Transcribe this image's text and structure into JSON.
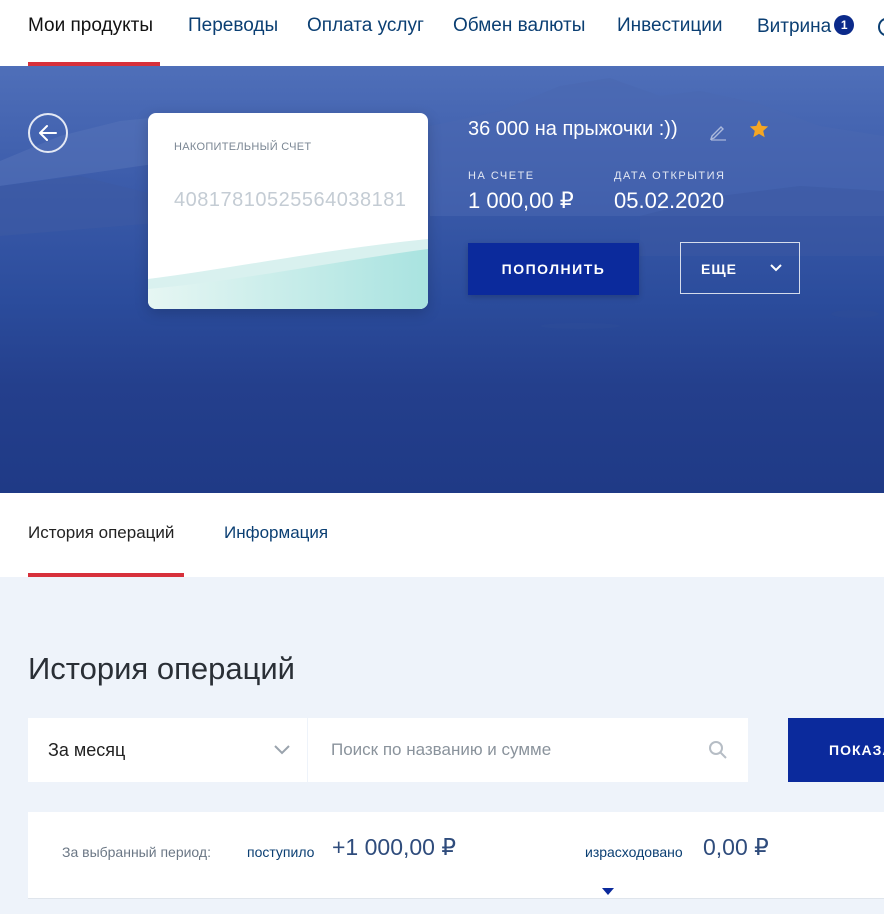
{
  "nav": {
    "items": [
      {
        "label": "Мои продукты",
        "active": true
      },
      {
        "label": "Переводы"
      },
      {
        "label": "Оплата услуг"
      },
      {
        "label": "Обмен валюты"
      },
      {
        "label": "Инвестиции"
      },
      {
        "label": "Витрина",
        "badge": "1"
      }
    ]
  },
  "account": {
    "card_label": "НАКОПИТЕЛЬНЫЙ СЧЕТ",
    "card_number": "40817810525564038181",
    "title": "36 000 на прыжочки :))",
    "balance_label": "НА СЧЕТЕ",
    "balance": "1 000,00 ₽",
    "open_date_label": "ДАТА ОТКРЫТИЯ",
    "open_date": "05.02.2020",
    "topup_button": "ПОПОЛНИТЬ",
    "more_button": "ЕЩЕ",
    "favorite": true
  },
  "tabs": [
    {
      "label": "История операций",
      "active": true
    },
    {
      "label": "Информация"
    }
  ],
  "history": {
    "title": "История операций",
    "period": "За месяц",
    "search_placeholder": "Поиск по названию и сумме",
    "show_button": "ПОКАЗАТЬ",
    "summary": {
      "period_label": "За выбранный период:",
      "income_label": "поступило",
      "income_value": "+1 000,00 ₽",
      "expense_label": "израсходовано",
      "expense_value": "0,00 ₽"
    }
  },
  "colors": {
    "accent_red": "#d7303b",
    "primary_blue": "#0b2a9c",
    "link_blue": "#0b3f73",
    "favorite_star": "#f5a623"
  }
}
